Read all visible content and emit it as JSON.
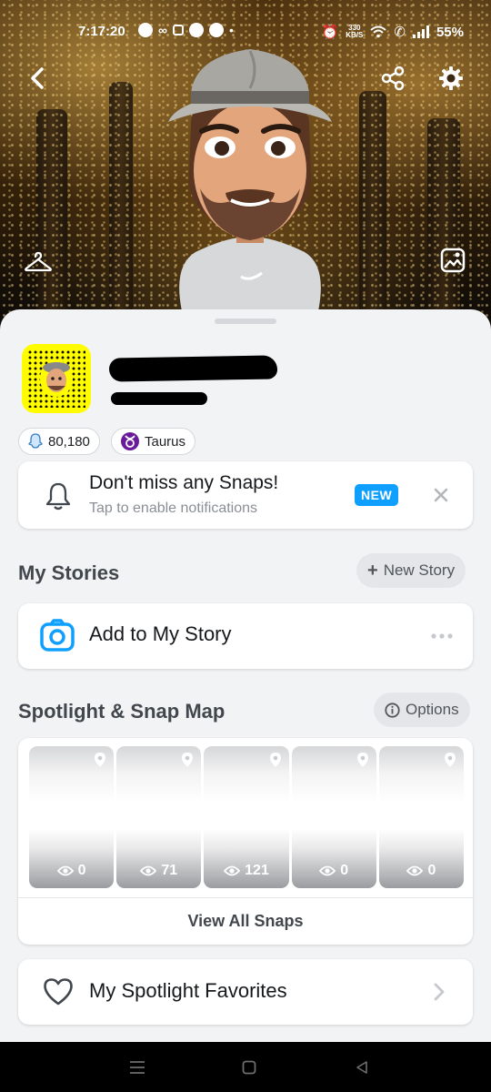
{
  "status_bar": {
    "time": "7:17:20",
    "net_speed_value": "330",
    "net_speed_unit": "KB/S",
    "battery": "55%"
  },
  "header": {
    "back_icon": "chevron-left-icon",
    "share_icon": "share-icon",
    "settings_icon": "gear-icon",
    "wardrobe_icon": "hanger-icon",
    "background_icon": "image-edit-icon"
  },
  "profile": {
    "snap_score": "80,180",
    "zodiac": "Taurus"
  },
  "notification_card": {
    "title": "Don't miss any Snaps!",
    "subtitle": "Tap to enable notifications",
    "badge": "NEW"
  },
  "my_stories": {
    "heading": "My Stories",
    "new_story_label": "New Story",
    "add_story_label": "Add to My Story"
  },
  "spotlight": {
    "heading": "Spotlight & Snap Map",
    "options_label": "Options",
    "snaps": [
      {
        "views": "0"
      },
      {
        "views": "71"
      },
      {
        "views": "121"
      },
      {
        "views": "0"
      },
      {
        "views": "0"
      }
    ],
    "view_all_label": "View All Snaps"
  },
  "favorites": {
    "label": "My Spotlight Favorites"
  },
  "colors": {
    "snap_yellow": "#fffc00",
    "accent_blue": "#0fa0ff",
    "zodiac_purple": "#6a1b9a"
  }
}
